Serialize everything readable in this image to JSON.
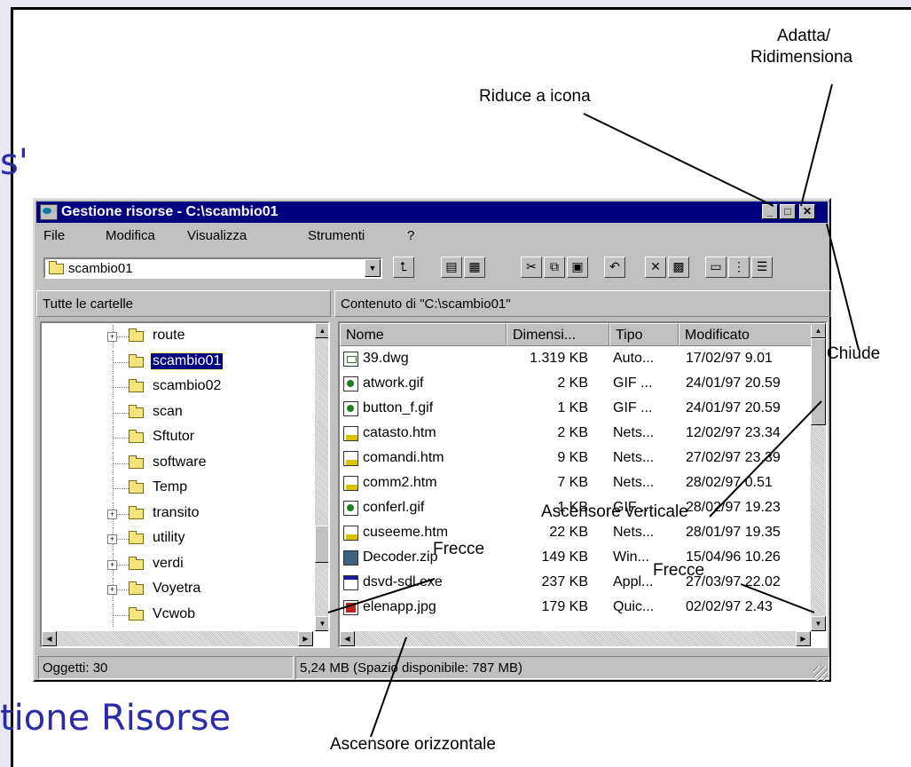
{
  "background": {
    "title_fragment": "s'",
    "bottom_text": "tione Risorse"
  },
  "window": {
    "title": "Gestione risorse - C:\\scambio01",
    "caption_buttons": {
      "minimize": "_",
      "maximize": "□",
      "close": "✕"
    },
    "menu": [
      "File",
      "Modifica",
      "Visualizza",
      "Strumenti",
      "?"
    ],
    "address_value": "scambio01",
    "toolbar_icons": [
      "up-folder-icon",
      "map-drive-icon",
      "disconnect-drive-icon",
      "cut-icon",
      "copy-icon",
      "paste-icon",
      "undo-icon",
      "delete-icon",
      "properties-icon",
      "large-icons-view-icon",
      "small-icons-view-icon",
      "list-view-icon"
    ],
    "left_header": "Tutte le cartelle",
    "right_header": "Contenuto di \"C:\\scambio01\"",
    "tree": [
      {
        "label": "route",
        "expander": "+"
      },
      {
        "label": "scambio01",
        "selected": true,
        "open": true
      },
      {
        "label": "scambio02"
      },
      {
        "label": "scan"
      },
      {
        "label": "Sftutor"
      },
      {
        "label": "software"
      },
      {
        "label": "Temp"
      },
      {
        "label": "transito",
        "expander": "+"
      },
      {
        "label": "utility",
        "expander": "+"
      },
      {
        "label": "verdi",
        "expander": "+"
      },
      {
        "label": "Voyetra",
        "expander": "+"
      },
      {
        "label": "Vcwob"
      }
    ],
    "columns": {
      "name": "Nome",
      "size": "Dimensi...",
      "type": "Tipo",
      "modified": "Modificato"
    },
    "files": [
      {
        "name": "39.dwg",
        "size": "1.319 KB",
        "type": "Auto...",
        "modified": "17/02/97 9.01",
        "icon": "dwg"
      },
      {
        "name": "atwork.gif",
        "size": "2 KB",
        "type": "GIF ...",
        "modified": "24/01/97 20.59",
        "icon": "gif"
      },
      {
        "name": "button_f.gif",
        "size": "1 KB",
        "type": "GIF ...",
        "modified": "24/01/97 20.59",
        "icon": "gif"
      },
      {
        "name": "catasto.htm",
        "size": "2 KB",
        "type": "Nets...",
        "modified": "12/02/97 23.34",
        "icon": "htm"
      },
      {
        "name": "comandi.htm",
        "size": "9 KB",
        "type": "Nets...",
        "modified": "27/02/97 23.39",
        "icon": "htm"
      },
      {
        "name": "comm2.htm",
        "size": "7 KB",
        "type": "Nets...",
        "modified": "28/02/97 0.51",
        "icon": "htm"
      },
      {
        "name": "conferl.gif",
        "size": "1 KB",
        "type": "GIF ...",
        "modified": "28/02/97 19.23",
        "icon": "gif"
      },
      {
        "name": "cuseeme.htm",
        "size": "22 KB",
        "type": "Nets...",
        "modified": "28/01/97 19.35",
        "icon": "htm"
      },
      {
        "name": "Decoder.zip",
        "size": "149 KB",
        "type": "Win...",
        "modified": "15/04/96 10.26",
        "icon": "zip"
      },
      {
        "name": "dsvd-sdl.exe",
        "size": "237 KB",
        "type": "Appl...",
        "modified": "27/03/97 22.02",
        "icon": "exe"
      },
      {
        "name": "elenapp.jpg",
        "size": "179 KB",
        "type": "Quic...",
        "modified": "02/02/97 2.43",
        "icon": "jpg"
      }
    ],
    "status_objects": "Oggetti: 30",
    "status_space": "5,24 MB (Spazio disponibile: 787 MB)"
  },
  "annotations": {
    "adatta": "Adatta/",
    "ridimensiona": "Ridimensiona",
    "riduce": "Riduce a icona",
    "chiude": "Chiude",
    "ascensore_verticale": "Ascensore verticale",
    "frecce_left": "Frecce",
    "frecce_right": "Frecce",
    "ascensore_orizzontale": "Ascensore orizzontale"
  },
  "colors": {
    "title_bar": "#000080",
    "window_face": "#c0c0c0",
    "slide_text": "#2b2ba8"
  }
}
